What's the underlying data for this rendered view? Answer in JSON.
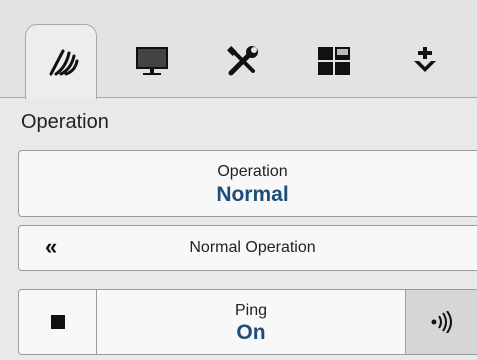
{
  "tabs": [
    {
      "icon": "sonar-icon",
      "active": true
    },
    {
      "icon": "monitor-icon",
      "active": false
    },
    {
      "icon": "tools-icon",
      "active": false
    },
    {
      "icon": "layout-icon",
      "active": false
    },
    {
      "icon": "download-icon",
      "active": false
    }
  ],
  "section": {
    "title": "Operation"
  },
  "operation": {
    "label": "Operation",
    "value": "Normal"
  },
  "mode": {
    "chevron": "«",
    "label": "Normal Operation"
  },
  "ping": {
    "label": "Ping",
    "value": "On",
    "stop_icon": "stop-icon",
    "signal_icon": "signal-icon"
  },
  "colors": {
    "value_text": "#1f4e79",
    "background": "#e9e9e9",
    "button_bg": "#f8f8f8",
    "border": "#9c9c9c"
  }
}
